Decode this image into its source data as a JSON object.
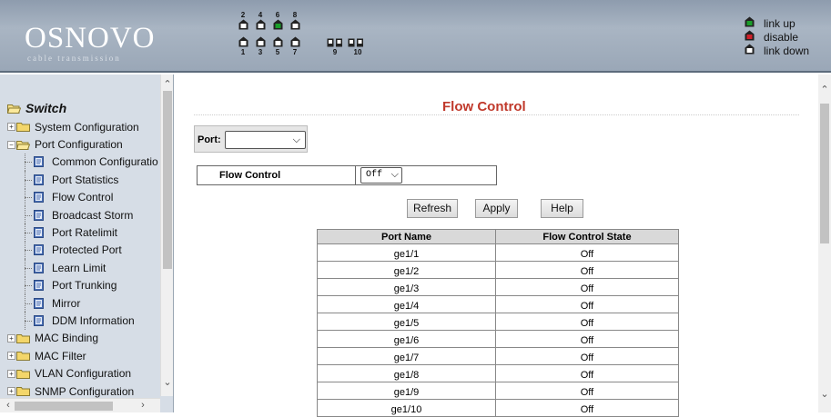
{
  "header": {
    "logo": "OSNOVO",
    "logo_sub": "cable transmission",
    "top_numbers": [
      "2",
      "4",
      "6",
      "8"
    ],
    "bottom_numbers": [
      "1",
      "3",
      "5",
      "7",
      "9",
      "10"
    ],
    "legend": [
      {
        "label": "link up",
        "color": "#1a9e2a"
      },
      {
        "label": "disable",
        "color": "#d0202a"
      },
      {
        "label": "link down",
        "color": "#ffffff"
      }
    ],
    "port_states": {
      "p2": "down",
      "p4": "down",
      "p6": "up",
      "p8": "down",
      "p1": "down",
      "p3": "down",
      "p5": "down",
      "p7": "down",
      "p9": "down",
      "p10": "down"
    }
  },
  "sidebar": {
    "root": "Switch",
    "items": [
      {
        "label": "System Configuration",
        "type": "folder",
        "expanded": false
      },
      {
        "label": "Port Configuration",
        "type": "folder",
        "expanded": true
      },
      {
        "label": "Common Configuratio",
        "type": "page"
      },
      {
        "label": "Port Statistics",
        "type": "page"
      },
      {
        "label": "Flow Control",
        "type": "page"
      },
      {
        "label": "Broadcast Storm",
        "type": "page"
      },
      {
        "label": "Port Ratelimit",
        "type": "page"
      },
      {
        "label": "Protected Port",
        "type": "page"
      },
      {
        "label": "Learn Limit",
        "type": "page"
      },
      {
        "label": "Port Trunking",
        "type": "page"
      },
      {
        "label": "Mirror",
        "type": "page"
      },
      {
        "label": "DDM Information",
        "type": "page"
      },
      {
        "label": "MAC Binding",
        "type": "folder",
        "expanded": false
      },
      {
        "label": "MAC Filter",
        "type": "folder",
        "expanded": false
      },
      {
        "label": "VLAN Configuration",
        "type": "folder",
        "expanded": false
      },
      {
        "label": "SNMP Configuration",
        "type": "folder",
        "expanded": false
      }
    ]
  },
  "main": {
    "title": "Flow Control",
    "port_label": "Port:",
    "port_value": "",
    "fc_label": "Flow Control",
    "fc_value": "Off",
    "buttons": {
      "refresh": "Refresh",
      "apply": "Apply",
      "help": "Help"
    },
    "table": {
      "headers": [
        "Port Name",
        "Flow Control State"
      ],
      "rows": [
        [
          "ge1/1",
          "Off"
        ],
        [
          "ge1/2",
          "Off"
        ],
        [
          "ge1/3",
          "Off"
        ],
        [
          "ge1/4",
          "Off"
        ],
        [
          "ge1/5",
          "Off"
        ],
        [
          "ge1/6",
          "Off"
        ],
        [
          "ge1/7",
          "Off"
        ],
        [
          "ge1/8",
          "Off"
        ],
        [
          "ge1/9",
          "Off"
        ],
        [
          "ge1/10",
          "Off"
        ]
      ]
    }
  }
}
